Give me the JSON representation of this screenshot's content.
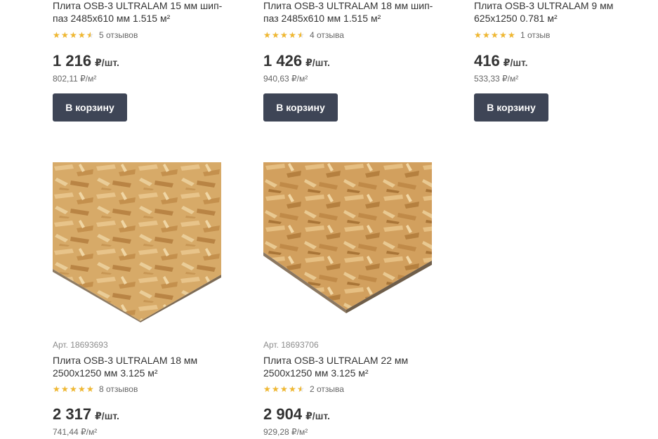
{
  "products": [
    {
      "title": "Плита OSB-3 ULTRALAM 15 мм шип-паз 2485x610 мм 1.515 м²",
      "rating": 4.5,
      "reviews": "5 отзывов",
      "price": "1 216",
      "unit": "₽/шт.",
      "unit_price": "802,11 ₽/м²",
      "button": "В корзину"
    },
    {
      "title": "Плита OSB-3 ULTRALAM 18 мм шип-паз 2485x610 мм 1.515 м²",
      "rating": 4.5,
      "reviews": "4 отзыва",
      "price": "1 426",
      "unit": "₽/шт.",
      "unit_price": "940,63 ₽/м²",
      "button": "В корзину"
    },
    {
      "title": "Плита OSB-3 ULTRALAM 9 мм 625x1250 0.781 м²",
      "rating": 5,
      "reviews": "1 отзыв",
      "price": "416",
      "unit": "₽/шт.",
      "unit_price": "533,33 ₽/м²",
      "button": "В корзину"
    },
    {
      "article": "Арт. 18693693",
      "title": "Плита OSB-3 ULTRALAM 18 мм 2500x1250 мм 3.125 м²",
      "rating": 5,
      "reviews": "8 отзывов",
      "price": "2 317",
      "unit": "₽/шт.",
      "unit_price": "741,44 ₽/м²"
    },
    {
      "article": "Арт. 18693706",
      "title": "Плита OSB-3 ULTRALAM 22 мм 2500x1250 мм 3.125 м²",
      "rating": 4.5,
      "reviews": "2 отзыва",
      "price": "2 904",
      "unit": "₽/шт.",
      "unit_price": "929,28 ₽/м²"
    }
  ],
  "icons": [
    "star-icon",
    "osb-board-image"
  ],
  "colors": {
    "star": "#f0b72f",
    "button_bg": "#3e4556",
    "board": "#d9ad6a"
  }
}
